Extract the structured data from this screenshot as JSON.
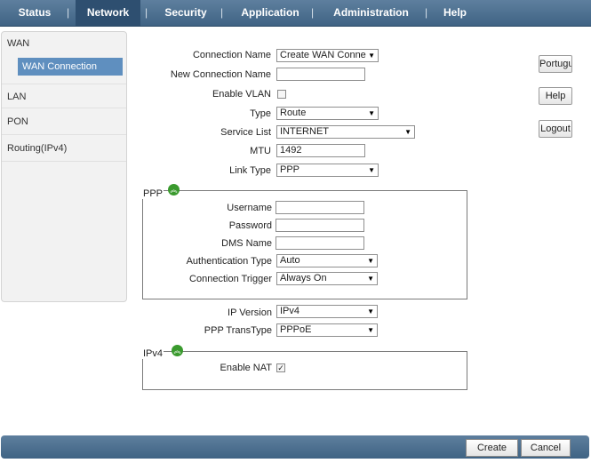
{
  "nav": {
    "tabs": [
      "Status",
      "Network",
      "Security",
      "Application",
      "Administration",
      "Help"
    ],
    "active": "Network"
  },
  "sidebar": {
    "items": [
      "WAN",
      "LAN",
      "PON",
      "Routing(IPv4)"
    ],
    "sub_item": "WAN Connection"
  },
  "form": {
    "connection_name": {
      "label": "Connection Name",
      "value": "Create WAN Conne"
    },
    "new_connection_name": {
      "label": "New Connection Name",
      "value": ""
    },
    "enable_vlan": {
      "label": "Enable VLAN",
      "checked": false
    },
    "type": {
      "label": "Type",
      "value": "Route"
    },
    "service_list": {
      "label": "Service List",
      "value": "INTERNET"
    },
    "mtu": {
      "label": "MTU",
      "value": "1492"
    },
    "link_type": {
      "label": "Link Type",
      "value": "PPP"
    }
  },
  "ppp": {
    "legend": "PPP",
    "username": {
      "label": "Username",
      "value": ""
    },
    "password": {
      "label": "Password",
      "value": ""
    },
    "dms_name": {
      "label": "DMS Name",
      "value": ""
    },
    "auth_type": {
      "label": "Authentication Type",
      "value": "Auto"
    },
    "conn_trigger": {
      "label": "Connection Trigger",
      "value": "Always On"
    }
  },
  "ip": {
    "version": {
      "label": "IP Version",
      "value": "IPv4"
    },
    "trans_type": {
      "label": "PPP TransType",
      "value": "PPPoE"
    }
  },
  "ipv4": {
    "legend": "IPv4",
    "enable_nat": {
      "label": "Enable NAT",
      "checked": true
    }
  },
  "side_buttons": {
    "language": "Portugu",
    "help": "Help",
    "logout": "Logout"
  },
  "footer": {
    "create": "Create",
    "cancel": "Cancel"
  },
  "icons": {
    "dropdown": "dropdown-arrow-icon",
    "collapse": "collapse-up-icon",
    "check": "checkmark-icon"
  },
  "colors": {
    "nav_bg": "#4a6d8f",
    "nav_active": "#2e4f70",
    "selected_sub": "#5f8fbf",
    "collapse_icon": "#3a9a2e"
  }
}
